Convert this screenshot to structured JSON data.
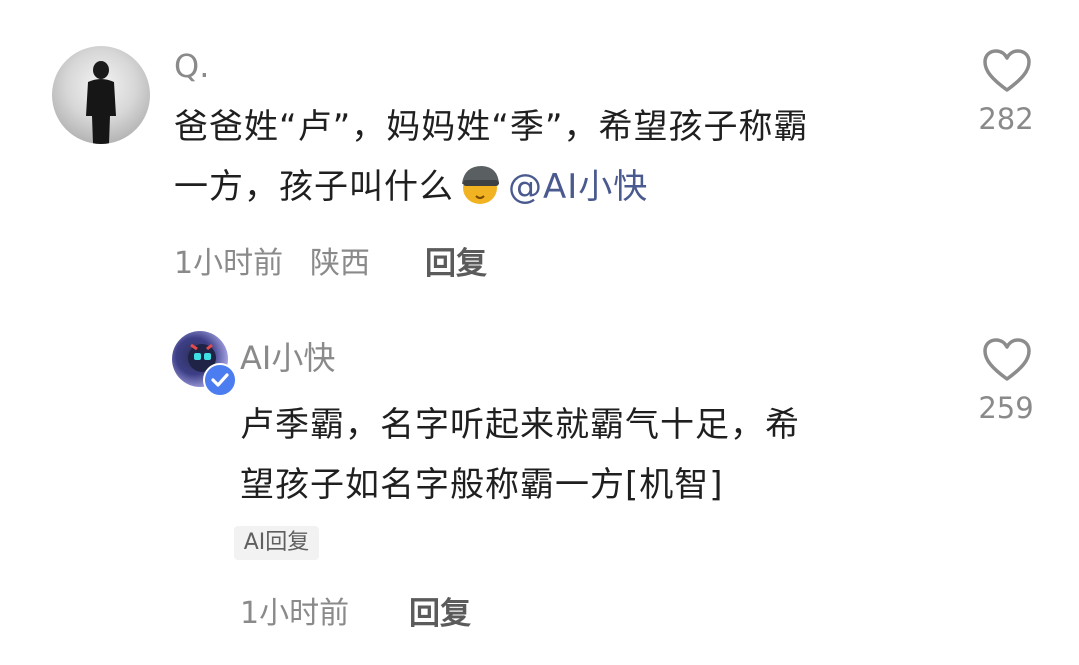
{
  "comment": {
    "username": "Q.",
    "text_line1": "爸爸姓“卢”，妈妈姓“季”，希望孩子称霸",
    "text_line2": "一方，孩子叫什么",
    "mention": "@AI小快",
    "time": "1小时前",
    "location": "陕西",
    "reply_label": "回复",
    "likes": "282",
    "icons": {
      "emoji": "helmet-emoji-icon",
      "like": "heart-outline-icon"
    }
  },
  "reply": {
    "username": "AI小快",
    "text_line1": "卢季霸，名字听起来就霸气十足，希",
    "text_line2": "望孩子如名字般称霸一方[机智]",
    "tag": "AI回复",
    "time": "1小时前",
    "reply_label": "回复",
    "likes": "259",
    "icons": {
      "verified": "verified-check-icon",
      "like": "heart-outline-icon"
    }
  },
  "colors": {
    "mention": "#4a5a8f",
    "verified": "#4b7df0",
    "meta": "#8a8a8a"
  }
}
